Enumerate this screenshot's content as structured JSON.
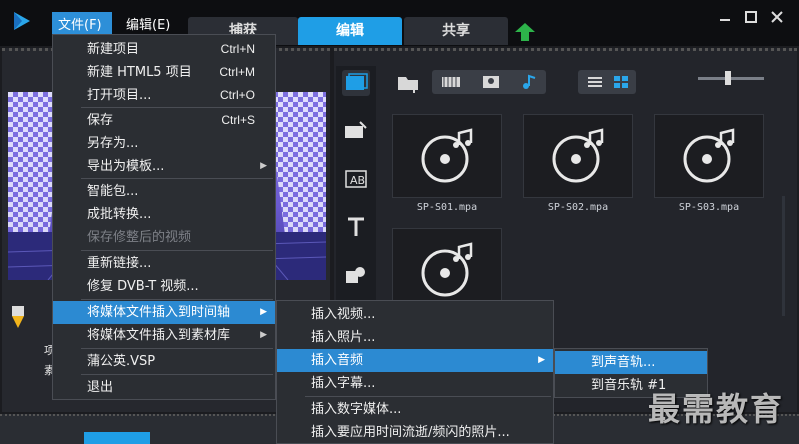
{
  "menubar": {
    "file": "文件(F)",
    "edit": "编辑(E)"
  },
  "tabs": {
    "capture": "捕获",
    "edit": "编辑",
    "share": "共享"
  },
  "file_menu": {
    "items": [
      {
        "label": "新建项目",
        "shortcut": "Ctrl+N"
      },
      {
        "label": "新建 HTML5 项目",
        "shortcut": "Ctrl+M"
      },
      {
        "label": "打开项目...",
        "shortcut": "Ctrl+O"
      },
      {
        "label": "保存",
        "shortcut": "Ctrl+S"
      },
      {
        "label": "另存为..."
      },
      {
        "label": "导出为模板..."
      },
      {
        "label": "智能包..."
      },
      {
        "label": "成批转换..."
      },
      {
        "label": "保存修整后的视频"
      },
      {
        "label": "重新链接..."
      },
      {
        "label": "修复 DVB-T 视频..."
      },
      {
        "label": "将媒体文件插入到时间轴"
      },
      {
        "label": "将媒体文件插入到素材库"
      },
      {
        "label": "蒲公英.VSP"
      },
      {
        "label": "退出"
      }
    ]
  },
  "insert_timeline_menu": {
    "items": [
      {
        "label": "插入视频..."
      },
      {
        "label": "插入照片..."
      },
      {
        "label": "插入音频"
      },
      {
        "label": "插入字幕..."
      },
      {
        "label": "插入数字媒体..."
      },
      {
        "label": "插入要应用时间流逝/频闪的照片..."
      }
    ]
  },
  "insert_audio_menu": {
    "items": [
      {
        "label": "到声音轨..."
      },
      {
        "label": "到音乐轨 #1"
      }
    ]
  },
  "library": {
    "clips": [
      {
        "label": "SP-S01.mpa"
      },
      {
        "label": "SP-S02.mpa"
      },
      {
        "label": "SP-S03.mpa"
      },
      {
        "label": ""
      }
    ]
  },
  "preview": {
    "label_1": "项",
    "label_2": "素"
  },
  "watermark": "最需教育",
  "colors": {
    "accent": "#1f9ee6",
    "menu_highlight": "#2c8ad2",
    "menu_bg": "#2b2e33",
    "upload_green": "#2db34a"
  },
  "icons": {
    "logo": "corel-play-icon",
    "upload": "upload-arrow-icon",
    "minimize": "minimize-icon",
    "maximize": "maximize-icon",
    "close": "close-icon"
  }
}
